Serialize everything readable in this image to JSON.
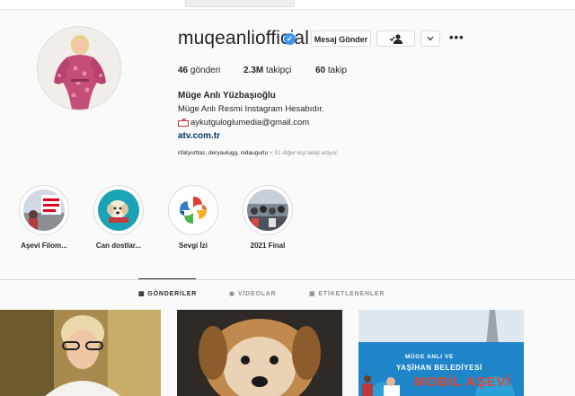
{
  "profile": {
    "username": "muqeanliofficial",
    "full_name": "Müge Anlı Yüzbaşıoğlu",
    "bio_line1": "Müge Anlı Resmi Instagram Hesabıdır.",
    "email": "aykutguloglumedia@gmail.com",
    "link": "atv.com.tr",
    "followed_by_names": "rifatyurttas, deryaulugg, nidaugurlu",
    "followed_by_more": "+ 51 diğer kişi takip ediyor"
  },
  "actions": {
    "message": "Mesaj Gönder",
    "more": "•••"
  },
  "stats": {
    "posts_count": "46",
    "posts_label": "gönderi",
    "followers_count": "2.3M",
    "followers_label": "takipçi",
    "following_count": "60",
    "following_label": "takip"
  },
  "highlights": [
    {
      "label": "Aşevi Filom..."
    },
    {
      "label": "Can dostlar..."
    },
    {
      "label": "Sevgi İzi"
    },
    {
      "label": "2021 Final"
    }
  ],
  "tabs": {
    "posts": "GÖNDERİLER",
    "videos": "VİDEOLAR",
    "tagged": "ETİKETLENENLER"
  },
  "post3_text": {
    "line1": "MÜGE ANLI VE",
    "line2": "YAŞİHAN BELEDİYESİ",
    "line3": "MOBİL AŞEVİ"
  },
  "colors": {
    "verified": "#3897f0",
    "link": "#00376b",
    "accent_red": "#e0001b"
  }
}
